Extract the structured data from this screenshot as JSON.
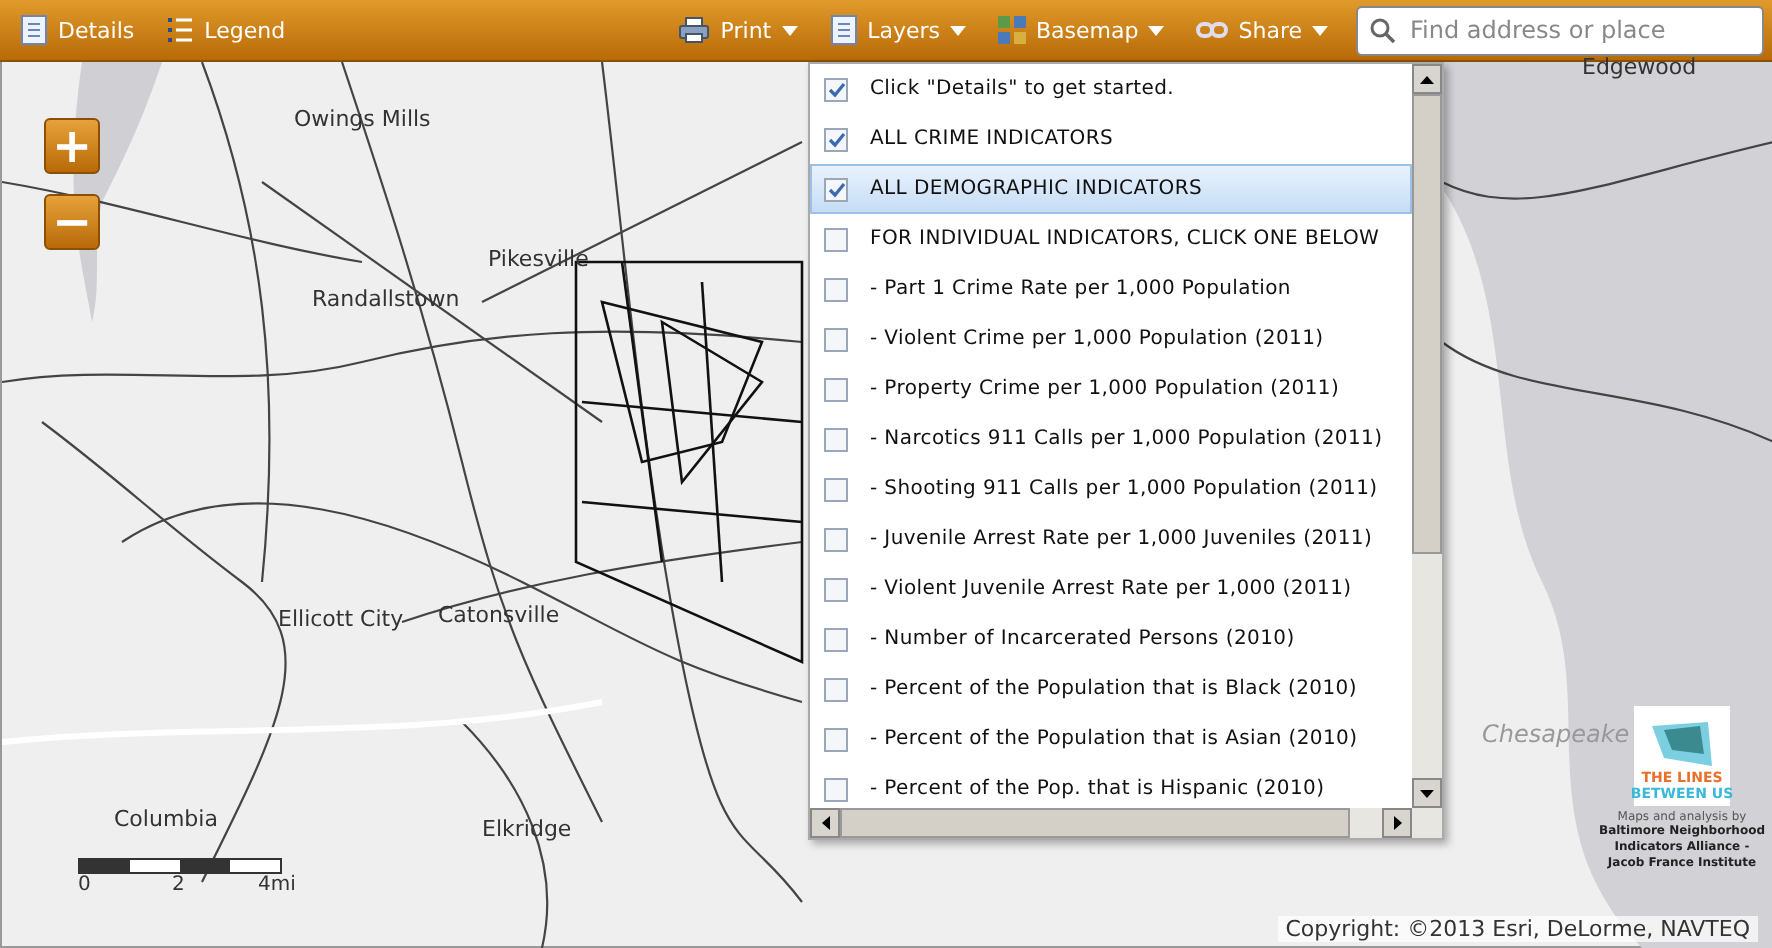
{
  "toolbar": {
    "left_buttons": [
      {
        "kind": "details",
        "label": "Details"
      },
      {
        "kind": "legend",
        "label": "Legend"
      }
    ],
    "menus": [
      {
        "kind": "print",
        "label": "Print"
      },
      {
        "kind": "layers",
        "label": "Layers"
      },
      {
        "kind": "basemap",
        "label": "Basemap"
      },
      {
        "kind": "share",
        "label": "Share"
      }
    ],
    "search": {
      "placeholder": "Find address or place"
    }
  },
  "map": {
    "zoom_controls": [
      "+",
      "−"
    ],
    "places": [
      {
        "name": "Owings Mills"
      },
      {
        "name": "Pikesville"
      },
      {
        "name": "Randallstown"
      },
      {
        "name": "Ellicott City"
      },
      {
        "name": "Catonsville"
      },
      {
        "name": "Columbia"
      },
      {
        "name": "Elkridge"
      },
      {
        "name": "Edgewood"
      },
      {
        "name": "Chesapeake"
      }
    ],
    "scale_labels": [
      "0",
      "2",
      "4mi"
    ],
    "logo": {
      "line_1": "THE LINES",
      "line_2": "BETWEEN US"
    },
    "credits": {
      "intro": "Maps and analysis by",
      "lines": [
        "Baltimore Neighborhood",
        "Indicators Alliance -",
        "Jacob France Institute"
      ]
    },
    "copyright": "Copyright: ©2013 Esri, DeLorme, NAVTEQ"
  },
  "layers_panel": {
    "items": [
      {
        "label": "Click \"Details\" to get started.",
        "checked": true,
        "selected": false
      },
      {
        "label": "ALL CRIME INDICATORS",
        "checked": true,
        "selected": false
      },
      {
        "label": "ALL DEMOGRAPHIC INDICATORS",
        "checked": true,
        "selected": true
      },
      {
        "label": "FOR INDIVIDUAL INDICATORS, CLICK ONE BELOW",
        "checked": false,
        "selected": false
      },
      {
        "label": "- Part 1 Crime Rate per 1,000 Population",
        "checked": false,
        "selected": false
      },
      {
        "label": "- Violent Crime per 1,000 Population (2011)",
        "checked": false,
        "selected": false
      },
      {
        "label": "- Property Crime per 1,000 Population (2011)",
        "checked": false,
        "selected": false
      },
      {
        "label": "- Narcotics 911 Calls per 1,000 Population (2011)",
        "checked": false,
        "selected": false
      },
      {
        "label": "- Shooting 911 Calls per 1,000 Population (2011)",
        "checked": false,
        "selected": false
      },
      {
        "label": "- Juvenile Arrest Rate per 1,000 Juveniles (2011)",
        "checked": false,
        "selected": false
      },
      {
        "label": "- Violent Juvenile Arrest Rate per 1,000 (2011)",
        "checked": false,
        "selected": false
      },
      {
        "label": "- Number of Incarcerated Persons (2010)",
        "checked": false,
        "selected": false
      },
      {
        "label": "- Percent of the Population that is Black (2010)",
        "checked": false,
        "selected": false
      },
      {
        "label": "- Percent of the Population that is Asian (2010)",
        "checked": false,
        "selected": false
      },
      {
        "label": "- Percent of the Pop. that is Hispanic (2010)",
        "checked": false,
        "selected": false
      }
    ]
  }
}
